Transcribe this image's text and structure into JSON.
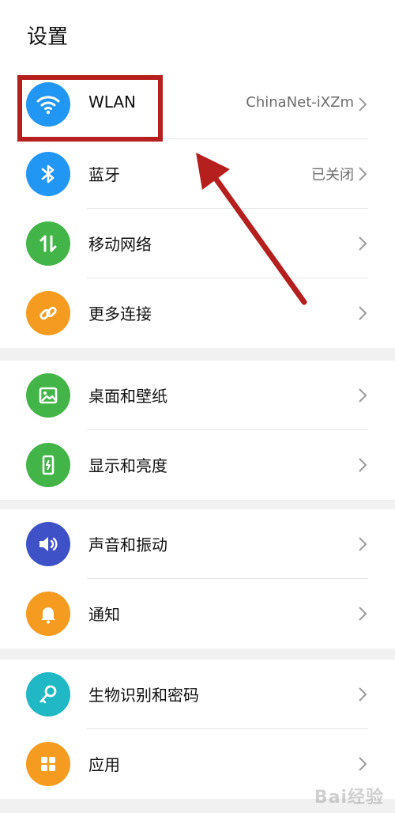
{
  "header": {
    "title": "设置"
  },
  "groups": [
    {
      "items": [
        {
          "label": "WLAN",
          "value": "ChinaNet-iXZm",
          "icon": "wifi-icon",
          "color": "#2196f3"
        },
        {
          "label": "蓝牙",
          "value": "已关闭",
          "icon": "bluetooth-icon",
          "color": "#2196f3"
        },
        {
          "label": "移动网络",
          "value": "",
          "icon": "mobile-network-icon",
          "color": "#43b548"
        },
        {
          "label": "更多连接",
          "value": "",
          "icon": "link-icon",
          "color": "#f59b1f"
        }
      ]
    },
    {
      "items": [
        {
          "label": "桌面和壁纸",
          "value": "",
          "icon": "wallpaper-icon",
          "color": "#43b548"
        },
        {
          "label": "显示和亮度",
          "value": "",
          "icon": "display-icon",
          "color": "#43b548"
        }
      ]
    },
    {
      "items": [
        {
          "label": "声音和振动",
          "value": "",
          "icon": "sound-icon",
          "color": "#3f51c7"
        },
        {
          "label": "通知",
          "value": "",
          "icon": "bell-icon",
          "color": "#f59b1f"
        }
      ]
    },
    {
      "items": [
        {
          "label": "生物识别和密码",
          "value": "",
          "icon": "key-icon",
          "color": "#20b8c4"
        },
        {
          "label": "应用",
          "value": "",
          "icon": "apps-icon",
          "color": "#f59b1f"
        }
      ]
    }
  ],
  "annotation": {
    "highlight_color": "#b5201f"
  },
  "watermark": "Bai经验"
}
